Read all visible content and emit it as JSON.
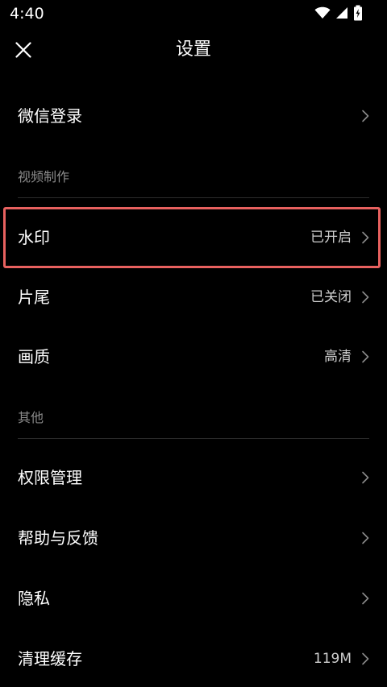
{
  "status_bar": {
    "time": "4:40",
    "icons": [
      "wifi-icon",
      "signal-icon",
      "battery-charging-icon"
    ]
  },
  "header": {
    "title": "设置",
    "close_icon": "close-icon"
  },
  "rows": {
    "wechat_login": {
      "label": "微信登录",
      "value": ""
    },
    "watermark": {
      "label": "水印",
      "value": "已开启"
    },
    "ending": {
      "label": "片尾",
      "value": "已关闭"
    },
    "quality": {
      "label": "画质",
      "value": "高清"
    },
    "permissions": {
      "label": "权限管理",
      "value": ""
    },
    "help_feedback": {
      "label": "帮助与反馈",
      "value": ""
    },
    "privacy": {
      "label": "隐私",
      "value": ""
    },
    "clear_cache": {
      "label": "清理缓存",
      "value": "119M"
    }
  },
  "sections": {
    "video_making": "视频制作",
    "other": "其他"
  },
  "colors": {
    "background": "#000000",
    "text": "#ffffff",
    "secondary_text": "#8a8a8a",
    "value_text": "#cfcfcf",
    "highlight_border": "#e8615f"
  }
}
